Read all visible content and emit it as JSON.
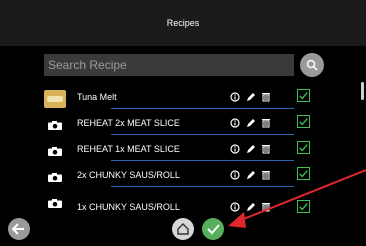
{
  "header": {
    "title": "Recipes"
  },
  "search": {
    "placeholder": "Search Recipe"
  },
  "recipes": [
    {
      "name": "Tuna Melt",
      "icon": "food-thumbnail"
    },
    {
      "name": "REHEAT 2x MEAT SLICE",
      "icon": "camera-icon"
    },
    {
      "name": "REHEAT 1x MEAT SLICE",
      "icon": "camera-icon"
    },
    {
      "name": "2x CHUNKY SAUS/ROLL",
      "icon": "camera-icon"
    },
    {
      "name": "1x CHUNKY SAUS/ROLL",
      "icon": "camera-icon"
    }
  ],
  "icons": {
    "search": "search-icon",
    "info": "info-icon",
    "edit": "pencil-icon",
    "delete": "trash-icon",
    "check": "checkbox-icon",
    "back": "arrow-left-icon",
    "home": "home-icon",
    "confirm": "checkmark-icon"
  },
  "colors": {
    "accent": "#57ae5b",
    "divider": "#2e64b2",
    "annotation": "#e0262e"
  }
}
